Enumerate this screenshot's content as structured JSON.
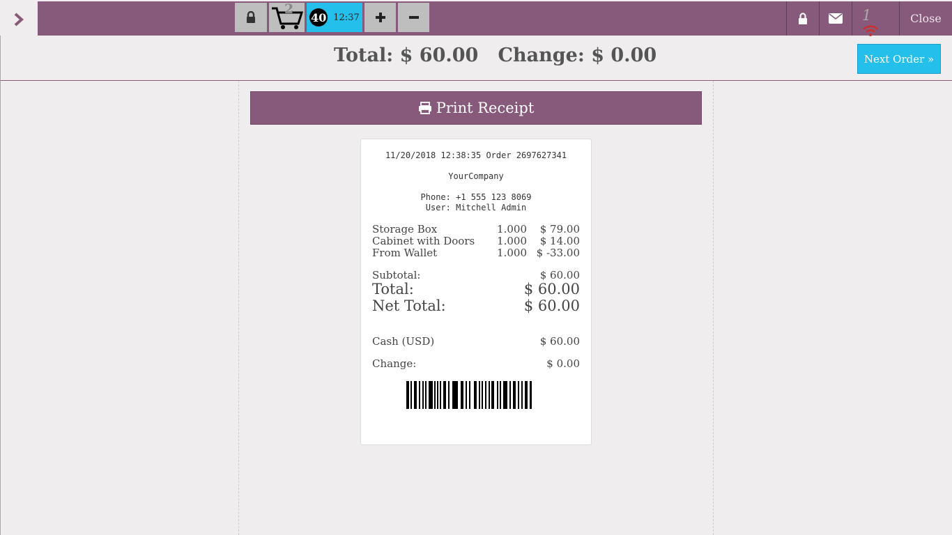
{
  "topbar": {
    "cart_count": "2",
    "order_number": "40",
    "order_time": "12:37",
    "proxy_count": "1",
    "close_label": "Close"
  },
  "header": {
    "totals_text": "Total: $ 60.00   Change: $ 0.00",
    "next_order_label": "Next Order »"
  },
  "print_button_label": "Print Receipt",
  "receipt": {
    "header_line": "11/20/2018 12:38:35 Order 2697627341",
    "company": "YourCompany",
    "phone": "Phone: +1 555 123 8069",
    "user": "User: Mitchell Admin",
    "lines": [
      {
        "name": "Storage Box",
        "qty": "1.000",
        "price": "$ 79.00"
      },
      {
        "name": "Cabinet with Doors",
        "qty": "1.000",
        "price": "$ 14.00"
      },
      {
        "name": "From Wallet",
        "qty": "1.000",
        "price": "$ -33.00"
      }
    ],
    "subtotal_label": "Subtotal:",
    "subtotal_value": "$ 60.00",
    "total_label": "Total:",
    "total_value": "$ 60.00",
    "net_total_label": "Net Total:",
    "net_total_value": "$ 60.00",
    "payment_label": "Cash (USD)",
    "payment_value": "$ 60.00",
    "change_label": "Change:",
    "change_value": "$ 0.00"
  },
  "colors": {
    "brand": "#875a7b",
    "accent": "#25bfec",
    "background": "#efedee",
    "warning_icon": "#c9302c"
  },
  "icons": [
    "chevron-right-icon",
    "lock-icon",
    "cart-icon",
    "plus-icon",
    "minus-icon",
    "envelope-icon",
    "wifi-icon",
    "printer-icon",
    "barcode-icon"
  ]
}
